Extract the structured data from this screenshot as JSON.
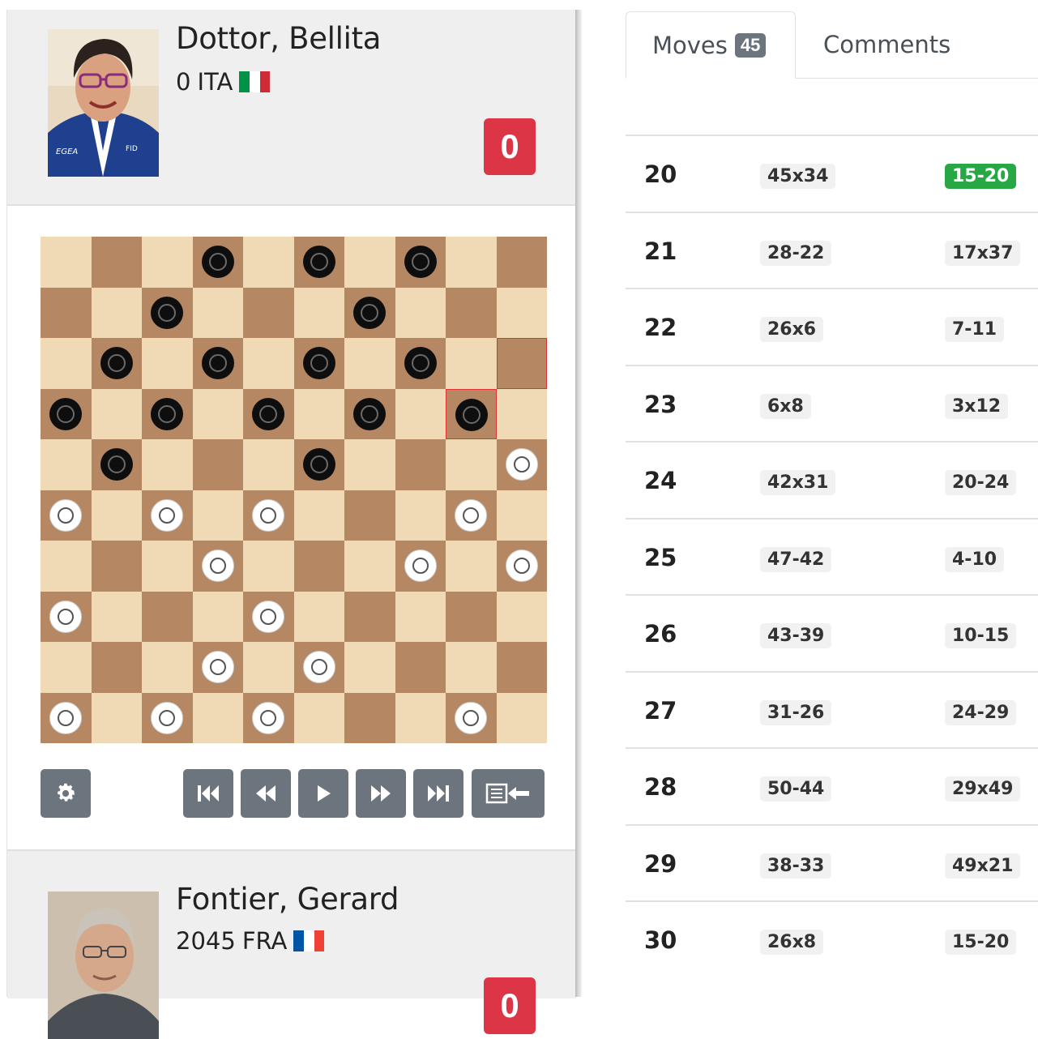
{
  "player_top": {
    "name": "Dottor, Bellita",
    "rating": "0",
    "country": "ITA",
    "flag_colors": [
      "#009246",
      "#ffffff",
      "#ce2b37"
    ],
    "score": "0"
  },
  "player_bottom": {
    "name": "Fontier, Gerard",
    "rating": "2045",
    "country": "FRA",
    "flag_colors": [
      "#0055a4",
      "#ffffff",
      "#ef4135"
    ],
    "score": "0"
  },
  "board": {
    "light_color": "#f0d9b5",
    "dark_color": "#b58863",
    "highlight_color": "#e03030",
    "black_pieces": [
      [
        0,
        3
      ],
      [
        0,
        5
      ],
      [
        0,
        7
      ],
      [
        1,
        2
      ],
      [
        1,
        6
      ],
      [
        2,
        1
      ],
      [
        2,
        3
      ],
      [
        2,
        5
      ],
      [
        2,
        7
      ],
      [
        3,
        0
      ],
      [
        3,
        2
      ],
      [
        3,
        4
      ],
      [
        3,
        6
      ],
      [
        3,
        8
      ],
      [
        4,
        1
      ],
      [
        4,
        5
      ]
    ],
    "white_pieces": [
      [
        4,
        9
      ],
      [
        5,
        0
      ],
      [
        5,
        2
      ],
      [
        5,
        4
      ],
      [
        5,
        8
      ],
      [
        6,
        3
      ],
      [
        6,
        7
      ],
      [
        6,
        9
      ],
      [
        7,
        0
      ],
      [
        7,
        4
      ],
      [
        8,
        3
      ],
      [
        8,
        5
      ],
      [
        9,
        0
      ],
      [
        9,
        2
      ],
      [
        9,
        4
      ],
      [
        9,
        8
      ]
    ],
    "highlighted_squares": [
      [
        2,
        9
      ],
      [
        3,
        8
      ]
    ]
  },
  "controls": {
    "settings_icon": "gear-icon",
    "first_icon": "skip-to-start-icon",
    "prev_icon": "rewind-icon",
    "play_icon": "play-icon",
    "next_icon": "fast-forward-icon",
    "last_icon": "skip-to-end-icon",
    "flip_icon": "list-arrow-left-icon"
  },
  "tabs": {
    "moves_label": "Moves",
    "moves_count": "45",
    "comments_label": "Comments"
  },
  "moves": [
    {
      "num": "20",
      "white": "45x34",
      "black": "15-20",
      "current": "black"
    },
    {
      "num": "21",
      "white": "28-22",
      "black": "17x37"
    },
    {
      "num": "22",
      "white": "26x6",
      "black": "7-11"
    },
    {
      "num": "23",
      "white": "6x8",
      "black": "3x12"
    },
    {
      "num": "24",
      "white": "42x31",
      "black": "20-24"
    },
    {
      "num": "25",
      "white": "47-42",
      "black": "4-10"
    },
    {
      "num": "26",
      "white": "43-39",
      "black": "10-15"
    },
    {
      "num": "27",
      "white": "31-26",
      "black": "24-29"
    },
    {
      "num": "28",
      "white": "50-44",
      "black": "29x49"
    },
    {
      "num": "29",
      "white": "38-33",
      "black": "49x21"
    },
    {
      "num": "30",
      "white": "26x8",
      "black": "15-20"
    }
  ]
}
